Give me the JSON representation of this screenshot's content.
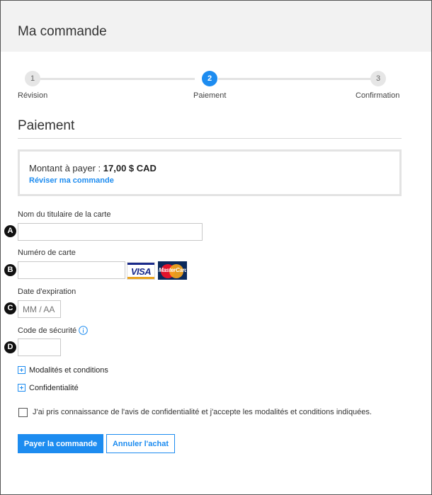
{
  "header": {
    "title": "Ma commande"
  },
  "steps": [
    {
      "number": "1",
      "label": "Révision",
      "active": false
    },
    {
      "number": "2",
      "label": "Paiement",
      "active": true
    },
    {
      "number": "3",
      "label": "Confirmation",
      "active": false
    }
  ],
  "section": {
    "title": "Paiement"
  },
  "summary": {
    "amount_label": "Montant à payer : ",
    "amount_value": "17,00 $ CAD",
    "review_link": "Réviser ma commande"
  },
  "form": {
    "cardholder": {
      "marker": "A",
      "label": "Nom du titulaire de la carte",
      "value": "",
      "placeholder": ""
    },
    "card_number": {
      "marker": "B",
      "label": "Numéro de carte",
      "value": "",
      "placeholder": ""
    },
    "expiry": {
      "marker": "C",
      "label": "Date d'expiration",
      "value": "",
      "placeholder": "MM / AA"
    },
    "security_code": {
      "marker": "D",
      "label": "Code de sécurité",
      "value": "",
      "placeholder": ""
    },
    "card_logos": {
      "visa": "VISA",
      "mastercard": "MasterCard"
    },
    "security_info_icon": "info-circle-icon"
  },
  "expandables": [
    {
      "label": "Modalités et conditions",
      "icon": "plus-square-icon"
    },
    {
      "label": "Confidentialité",
      "icon": "plus-square-icon"
    }
  ],
  "consent": {
    "checked": false,
    "text": "J'ai pris connaissance de l'avis de confidentialité et j'accepte les modalités et conditions indiquées."
  },
  "actions": {
    "pay_label": "Payer la commande",
    "cancel_label": "Annuler l'achat"
  },
  "colors": {
    "accent": "#1d8cf0",
    "header_bg": "#f2f2f2",
    "marker": "#111111"
  }
}
